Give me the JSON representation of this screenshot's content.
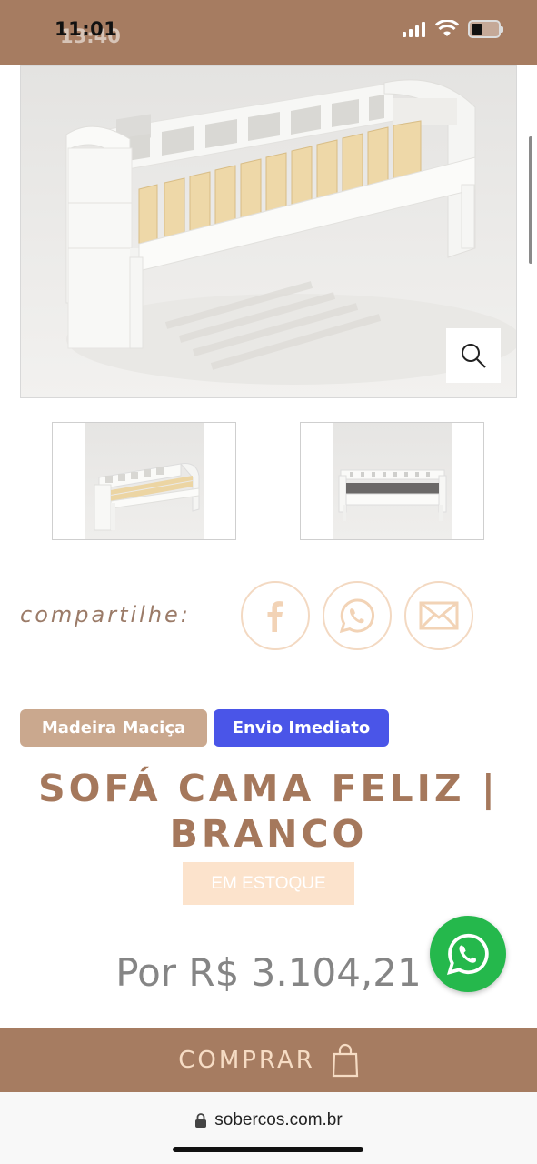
{
  "status_bar": {
    "time": "11:01",
    "time_ghost": "13:40",
    "icons": [
      "signal-icon",
      "wifi-icon",
      "battery-icon"
    ]
  },
  "product": {
    "badges": {
      "wood": "Madeira Maciça",
      "shipping": "Envio Imediato"
    },
    "title_line1": "SOFÁ CAMA FELIZ |",
    "title_line2": "BRANCO",
    "stock": "EM ESTOQUE",
    "price": "Por R$ 3.104,21"
  },
  "share": {
    "label": "compartilhe:",
    "icons": [
      "facebook-icon",
      "whatsapp-icon",
      "email-icon"
    ]
  },
  "buy_button": {
    "label": "COMPRAR"
  },
  "browser": {
    "url": "sobercos.com.br"
  },
  "colors": {
    "brand_brown": "#a67c61",
    "peach": "#fce3cc",
    "title_brown": "#a5785c",
    "shipping_blue": "#4a55e8",
    "whatsapp_green": "#25b84c"
  }
}
